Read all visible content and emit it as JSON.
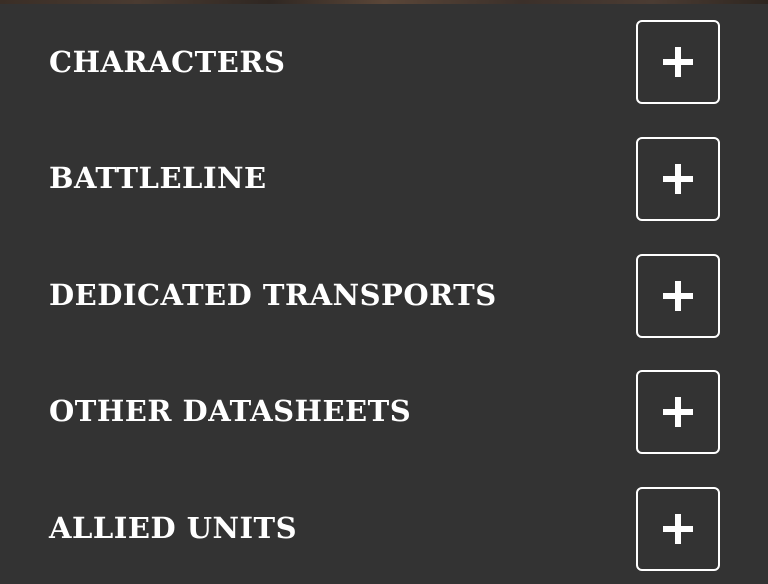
{
  "sections": [
    {
      "title": "CHARACTERS",
      "button_icon": "plus-icon",
      "expanded": false
    },
    {
      "title": "BATTLELINE",
      "button_icon": "plus-icon",
      "expanded": false
    },
    {
      "title": "DEDICATED TRANSPORTS",
      "button_icon": "plus-icon",
      "expanded": false
    },
    {
      "title": "OTHER DATASHEETS",
      "button_icon": "plus-icon",
      "expanded": false
    },
    {
      "title": "ALLIED UNITS",
      "button_icon": "plus-icon",
      "expanded": false
    }
  ],
  "colors": {
    "background": "#333333",
    "text": "#ffffff",
    "button_border": "#ffffff"
  }
}
